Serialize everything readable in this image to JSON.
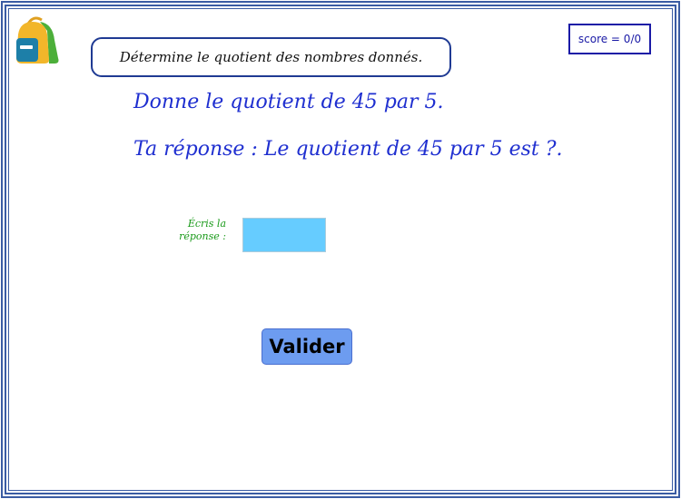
{
  "instruction": "Détermine le quotient des nombres donnés.",
  "score": "score = 0/0",
  "question": "Donne le quotient de 45 par 5.",
  "answer_prompt": "Ta réponse : Le quotient de 45 par 5 est ?.",
  "answer_label_line1": "Écris la",
  "answer_label_line2": "réponse :",
  "answer_value": "",
  "validate_label": "Valider",
  "colors": {
    "frame_border": "#3a5ba3",
    "text_blue": "#1f2fd0",
    "label_green": "#1a9a1a",
    "input_bg": "#66ccff",
    "button_bg": "#6d9cf0"
  },
  "icons": {
    "logo": "backpack-icon"
  }
}
